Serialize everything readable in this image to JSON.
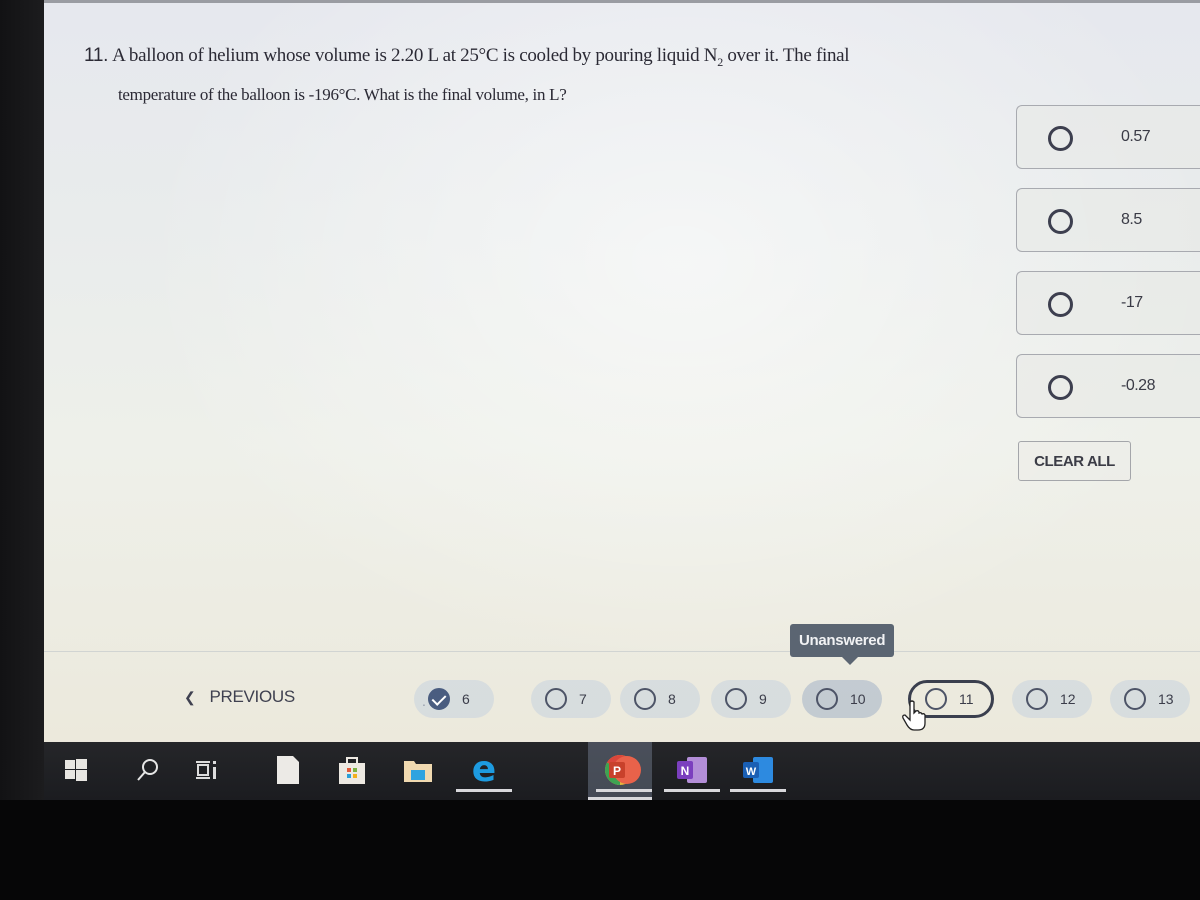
{
  "question": {
    "number": "11.",
    "text_line1_pre": "A balloon of helium whose volume is 2.20 L at 25°C is cooled by pouring liquid N",
    "text_line1_sub": "2",
    "text_line1_post": " over it. The final",
    "text_line2": "temperature of the balloon is -196°C. What is the final volume, in L?"
  },
  "options": [
    {
      "label": "0.57",
      "selected": false
    },
    {
      "label": "8.5",
      "selected": false
    },
    {
      "label": "-17",
      "selected": false
    },
    {
      "label": "-0.28",
      "selected": false
    }
  ],
  "clear_all_label": "CLEAR ALL",
  "tooltip": "Unanswered",
  "navigation": {
    "previous_label": "PREVIOUS",
    "ellipsis": "...",
    "questions": [
      {
        "number": "6",
        "status": "answered"
      },
      {
        "number": "7",
        "status": "unanswered"
      },
      {
        "number": "8",
        "status": "unanswered"
      },
      {
        "number": "9",
        "status": "unanswered"
      },
      {
        "number": "10",
        "status": "unanswered",
        "hovered": true
      },
      {
        "number": "11",
        "status": "unanswered",
        "current": true
      },
      {
        "number": "12",
        "status": "unanswered"
      },
      {
        "number": "13",
        "status": "unanswered"
      }
    ]
  },
  "taskbar": {
    "items": [
      {
        "icon": "windows-start-icon"
      },
      {
        "icon": "search-icon"
      },
      {
        "icon": "task-view-icon"
      },
      {
        "icon": "file-icon"
      },
      {
        "icon": "microsoft-store-icon"
      },
      {
        "icon": "file-explorer-icon"
      },
      {
        "icon": "edge-icon",
        "open": true
      },
      {
        "icon": "chrome-icon",
        "open": true,
        "active": true
      },
      {
        "icon": "powerpoint-icon",
        "open": true,
        "letter": "P"
      },
      {
        "icon": "onenote-icon",
        "open": true,
        "letter": "N"
      },
      {
        "icon": "word-icon",
        "open": true,
        "letter": "W"
      }
    ]
  },
  "colors": {
    "answered": "#4a5d80",
    "tooltip_bg": "#5b6572",
    "pill_bg": "#c6d2de"
  }
}
